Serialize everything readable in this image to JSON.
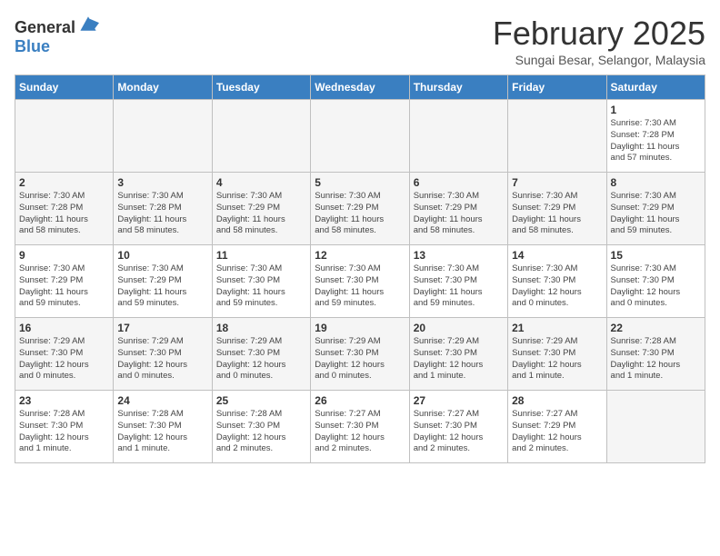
{
  "header": {
    "logo_general": "General",
    "logo_blue": "Blue",
    "month_title": "February 2025",
    "subtitle": "Sungai Besar, Selangor, Malaysia"
  },
  "days_of_week": [
    "Sunday",
    "Monday",
    "Tuesday",
    "Wednesday",
    "Thursday",
    "Friday",
    "Saturday"
  ],
  "weeks": [
    [
      {
        "day": "",
        "info": ""
      },
      {
        "day": "",
        "info": ""
      },
      {
        "day": "",
        "info": ""
      },
      {
        "day": "",
        "info": ""
      },
      {
        "day": "",
        "info": ""
      },
      {
        "day": "",
        "info": ""
      },
      {
        "day": "1",
        "info": "Sunrise: 7:30 AM\nSunset: 7:28 PM\nDaylight: 11 hours\nand 57 minutes."
      }
    ],
    [
      {
        "day": "2",
        "info": "Sunrise: 7:30 AM\nSunset: 7:28 PM\nDaylight: 11 hours\nand 58 minutes."
      },
      {
        "day": "3",
        "info": "Sunrise: 7:30 AM\nSunset: 7:28 PM\nDaylight: 11 hours\nand 58 minutes."
      },
      {
        "day": "4",
        "info": "Sunrise: 7:30 AM\nSunset: 7:29 PM\nDaylight: 11 hours\nand 58 minutes."
      },
      {
        "day": "5",
        "info": "Sunrise: 7:30 AM\nSunset: 7:29 PM\nDaylight: 11 hours\nand 58 minutes."
      },
      {
        "day": "6",
        "info": "Sunrise: 7:30 AM\nSunset: 7:29 PM\nDaylight: 11 hours\nand 58 minutes."
      },
      {
        "day": "7",
        "info": "Sunrise: 7:30 AM\nSunset: 7:29 PM\nDaylight: 11 hours\nand 58 minutes."
      },
      {
        "day": "8",
        "info": "Sunrise: 7:30 AM\nSunset: 7:29 PM\nDaylight: 11 hours\nand 59 minutes."
      }
    ],
    [
      {
        "day": "9",
        "info": "Sunrise: 7:30 AM\nSunset: 7:29 PM\nDaylight: 11 hours\nand 59 minutes."
      },
      {
        "day": "10",
        "info": "Sunrise: 7:30 AM\nSunset: 7:29 PM\nDaylight: 11 hours\nand 59 minutes."
      },
      {
        "day": "11",
        "info": "Sunrise: 7:30 AM\nSunset: 7:30 PM\nDaylight: 11 hours\nand 59 minutes."
      },
      {
        "day": "12",
        "info": "Sunrise: 7:30 AM\nSunset: 7:30 PM\nDaylight: 11 hours\nand 59 minutes."
      },
      {
        "day": "13",
        "info": "Sunrise: 7:30 AM\nSunset: 7:30 PM\nDaylight: 11 hours\nand 59 minutes."
      },
      {
        "day": "14",
        "info": "Sunrise: 7:30 AM\nSunset: 7:30 PM\nDaylight: 12 hours\nand 0 minutes."
      },
      {
        "day": "15",
        "info": "Sunrise: 7:30 AM\nSunset: 7:30 PM\nDaylight: 12 hours\nand 0 minutes."
      }
    ],
    [
      {
        "day": "16",
        "info": "Sunrise: 7:29 AM\nSunset: 7:30 PM\nDaylight: 12 hours\nand 0 minutes."
      },
      {
        "day": "17",
        "info": "Sunrise: 7:29 AM\nSunset: 7:30 PM\nDaylight: 12 hours\nand 0 minutes."
      },
      {
        "day": "18",
        "info": "Sunrise: 7:29 AM\nSunset: 7:30 PM\nDaylight: 12 hours\nand 0 minutes."
      },
      {
        "day": "19",
        "info": "Sunrise: 7:29 AM\nSunset: 7:30 PM\nDaylight: 12 hours\nand 0 minutes."
      },
      {
        "day": "20",
        "info": "Sunrise: 7:29 AM\nSunset: 7:30 PM\nDaylight: 12 hours\nand 1 minute."
      },
      {
        "day": "21",
        "info": "Sunrise: 7:29 AM\nSunset: 7:30 PM\nDaylight: 12 hours\nand 1 minute."
      },
      {
        "day": "22",
        "info": "Sunrise: 7:28 AM\nSunset: 7:30 PM\nDaylight: 12 hours\nand 1 minute."
      }
    ],
    [
      {
        "day": "23",
        "info": "Sunrise: 7:28 AM\nSunset: 7:30 PM\nDaylight: 12 hours\nand 1 minute."
      },
      {
        "day": "24",
        "info": "Sunrise: 7:28 AM\nSunset: 7:30 PM\nDaylight: 12 hours\nand 1 minute."
      },
      {
        "day": "25",
        "info": "Sunrise: 7:28 AM\nSunset: 7:30 PM\nDaylight: 12 hours\nand 2 minutes."
      },
      {
        "day": "26",
        "info": "Sunrise: 7:27 AM\nSunset: 7:30 PM\nDaylight: 12 hours\nand 2 minutes."
      },
      {
        "day": "27",
        "info": "Sunrise: 7:27 AM\nSunset: 7:30 PM\nDaylight: 12 hours\nand 2 minutes."
      },
      {
        "day": "28",
        "info": "Sunrise: 7:27 AM\nSunset: 7:29 PM\nDaylight: 12 hours\nand 2 minutes."
      },
      {
        "day": "",
        "info": ""
      }
    ]
  ]
}
